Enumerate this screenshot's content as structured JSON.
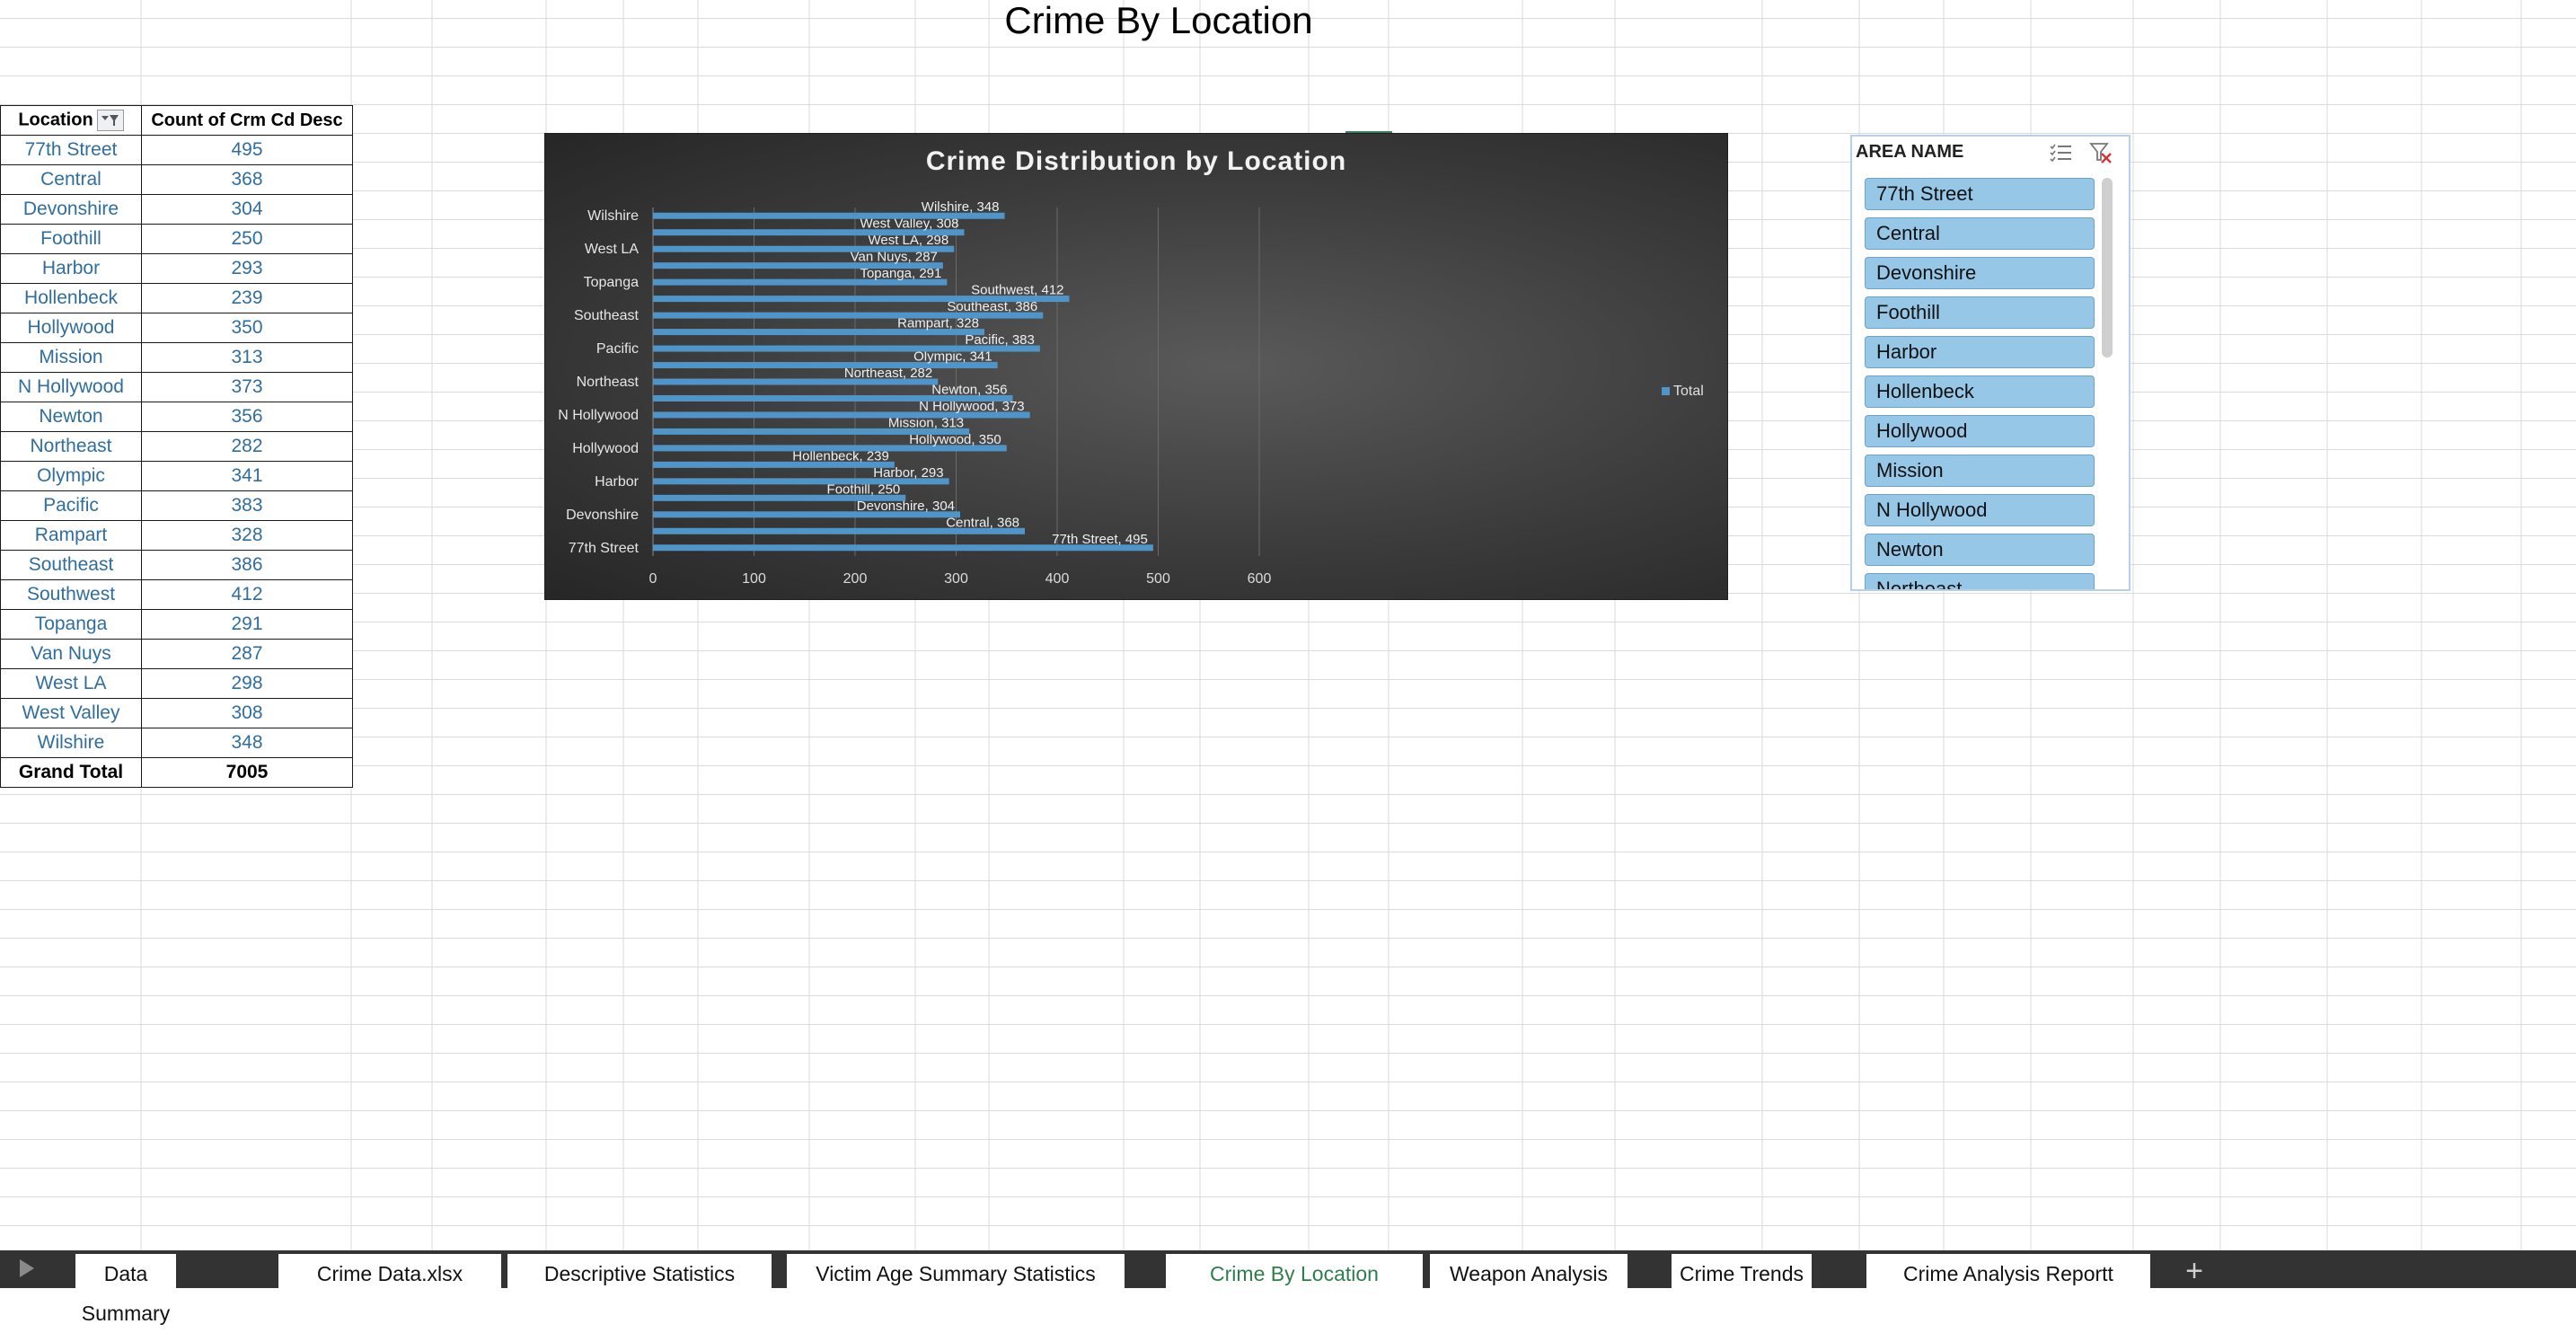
{
  "sheet_title": "Crime By Location",
  "pivot": {
    "headers": [
      "Location",
      "Count of Crm Cd Desc"
    ],
    "rows": [
      {
        "location": "77th Street",
        "count": "495"
      },
      {
        "location": "Central",
        "count": "368"
      },
      {
        "location": "Devonshire",
        "count": "304"
      },
      {
        "location": "Foothill",
        "count": "250"
      },
      {
        "location": "Harbor",
        "count": "293"
      },
      {
        "location": "Hollenbeck",
        "count": "239"
      },
      {
        "location": "Hollywood",
        "count": "350"
      },
      {
        "location": "Mission",
        "count": "313"
      },
      {
        "location": "N Hollywood",
        "count": "373"
      },
      {
        "location": "Newton",
        "count": "356"
      },
      {
        "location": "Northeast",
        "count": "282"
      },
      {
        "location": "Olympic",
        "count": "341"
      },
      {
        "location": "Pacific",
        "count": "383"
      },
      {
        "location": "Rampart",
        "count": "328"
      },
      {
        "location": "Southeast",
        "count": "386"
      },
      {
        "location": "Southwest",
        "count": "412"
      },
      {
        "location": "Topanga",
        "count": "291"
      },
      {
        "location": "Van Nuys",
        "count": "287"
      },
      {
        "location": "West LA",
        "count": "298"
      },
      {
        "location": "West Valley",
        "count": "308"
      },
      {
        "location": "Wilshire",
        "count": "348"
      }
    ],
    "total_label": "Grand Total",
    "total_value": "7005"
  },
  "chart_data": {
    "type": "bar",
    "orientation": "horizontal",
    "title": "Crime Distribution by Location",
    "categories": [
      "77th Street",
      "Central",
      "Devonshire",
      "Foothill",
      "Harbor",
      "Hollenbeck",
      "Hollywood",
      "Mission",
      "N Hollywood",
      "Newton",
      "Northeast",
      "Olympic",
      "Pacific",
      "Rampart",
      "Southeast",
      "Southwest",
      "Topanga",
      "Van Nuys",
      "West LA",
      "West Valley",
      "Wilshire"
    ],
    "axis_labels": [
      "77th Street",
      "Devonshire",
      "Harbor",
      "Hollywood",
      "N Hollywood",
      "Northeast",
      "Pacific",
      "Southeast",
      "Topanga",
      "West LA",
      "Wilshire"
    ],
    "series": [
      {
        "name": "Total",
        "values": [
          495,
          368,
          304,
          250,
          293,
          239,
          350,
          313,
          373,
          356,
          282,
          341,
          383,
          328,
          386,
          412,
          291,
          287,
          298,
          308,
          348
        ]
      }
    ],
    "xlim": [
      0,
      640
    ],
    "xticks": [
      0,
      100,
      200,
      300,
      400,
      500,
      600
    ],
    "grid": true,
    "legend": "right",
    "data_labels": true,
    "bar_color": "#4f95c9"
  },
  "slicer": {
    "title": "AREA NAME",
    "items": [
      "77th Street",
      "Central",
      "Devonshire",
      "Foothill",
      "Harbor",
      "Hollenbeck",
      "Hollywood",
      "Mission",
      "N Hollywood",
      "Newton",
      "Northeast"
    ]
  },
  "tabs": [
    {
      "label": "Data Summary"
    },
    {
      "label": "Crime Data.xlsx"
    },
    {
      "label": "Descriptive Statistics"
    },
    {
      "label": "Victim Age Summary Statistics"
    },
    {
      "label": "Crime By Location",
      "active": true
    },
    {
      "label": "Weapon Analysis"
    },
    {
      "label": "Crime Trends"
    },
    {
      "label": "Crime Analysis Reportt"
    }
  ],
  "add_sheet_label": "+"
}
